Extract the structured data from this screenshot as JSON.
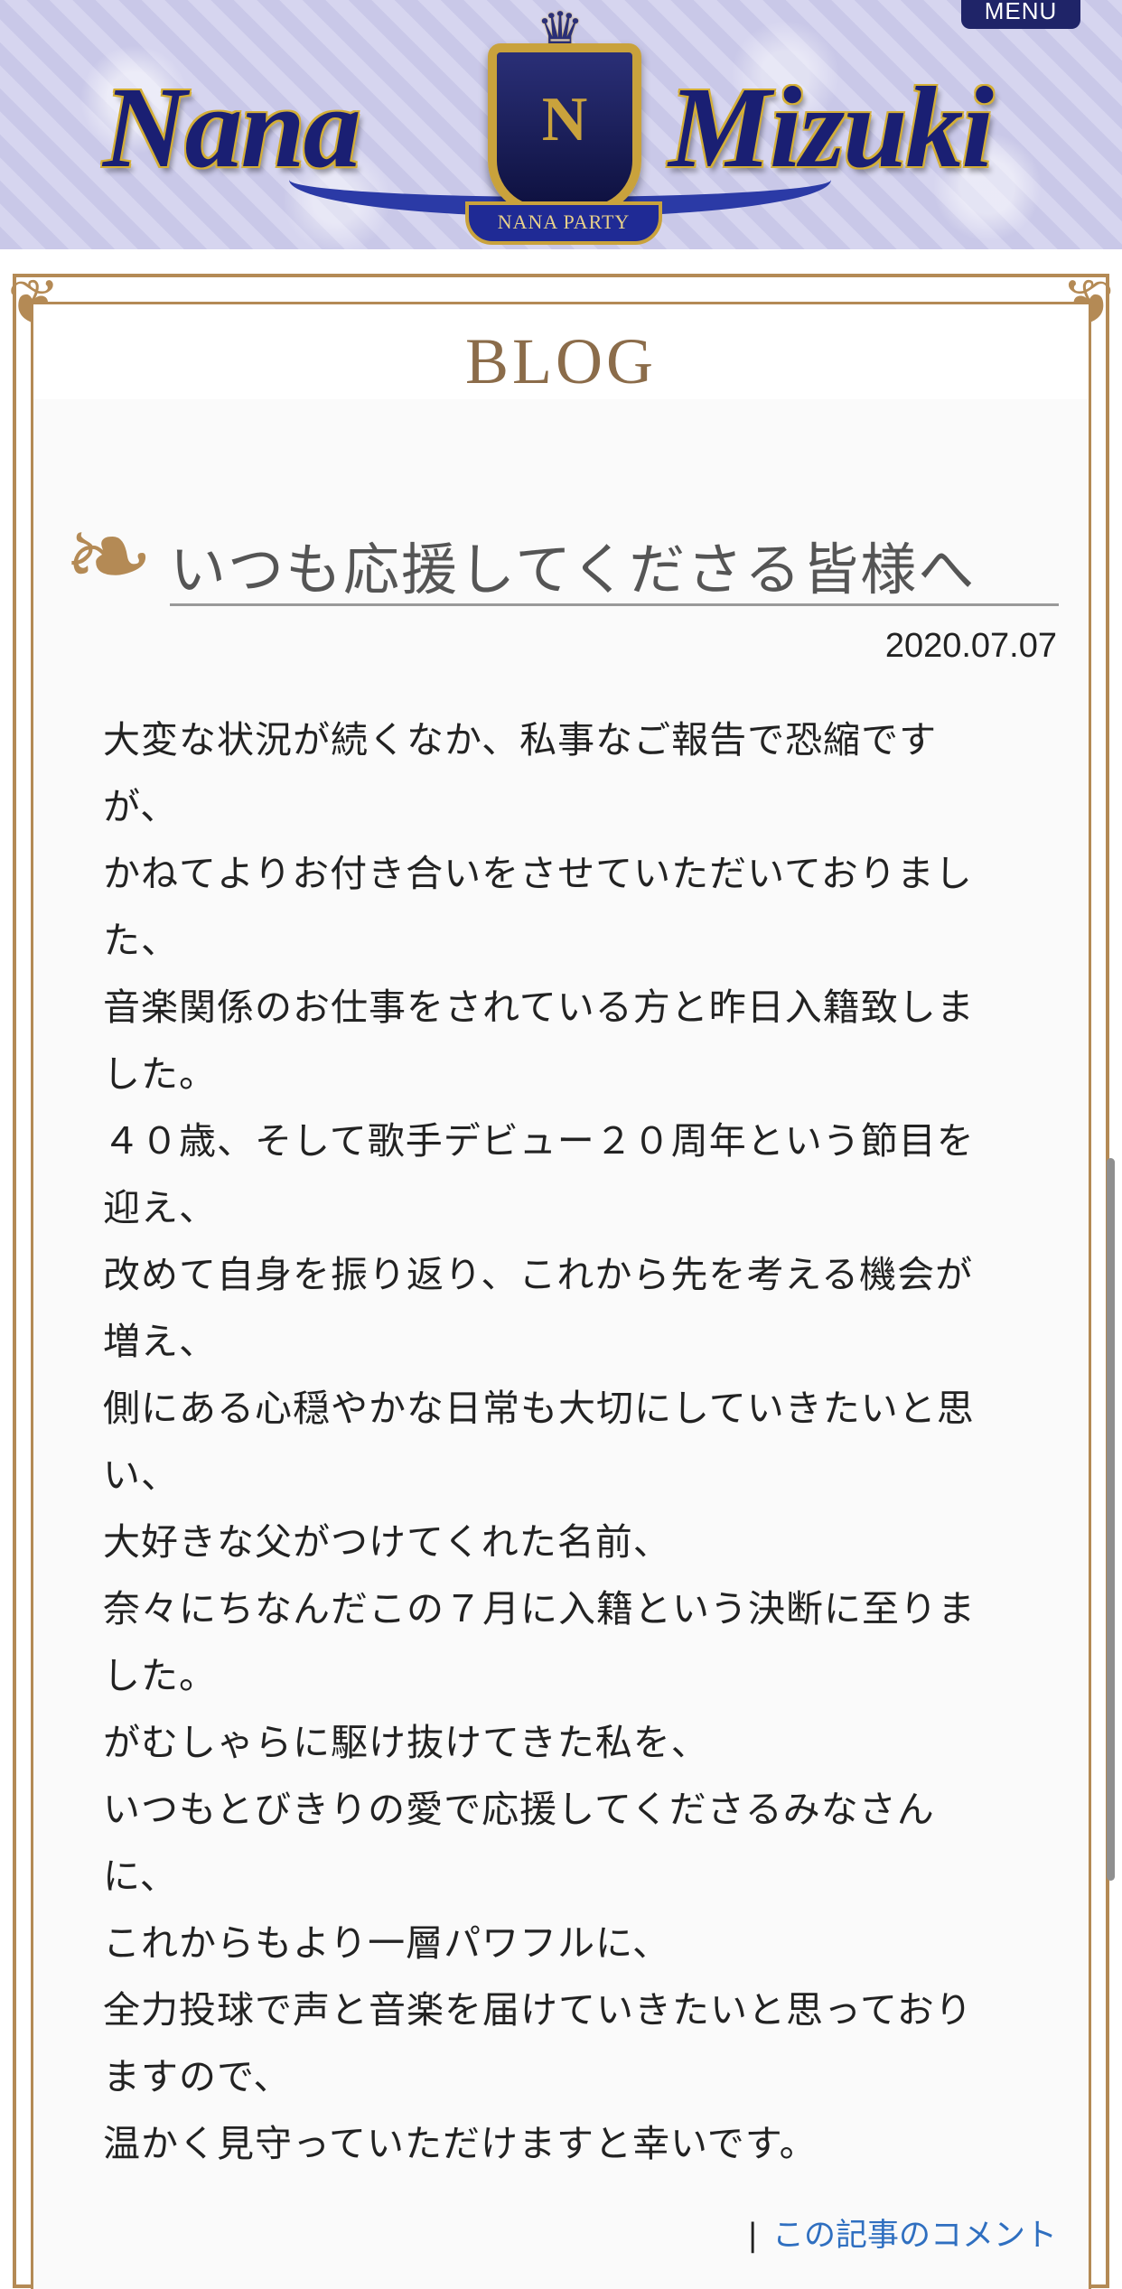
{
  "header": {
    "menu_label": "MENU",
    "logo_left": "Nana",
    "logo_right": "Mizuki",
    "crest_letter": "N",
    "tagline": "NANA PARTY"
  },
  "section": {
    "title": "BLOG"
  },
  "post": {
    "title": "いつも応援してくださる皆様へ",
    "date": "2020.07.07",
    "body_lines": [
      "大変な状況が続くなか、私事なご報告で恐縮です",
      "が、",
      "かねてよりお付き合いをさせていただいておりまし",
      "た、",
      "音楽関係のお仕事をされている方と昨日入籍致しま",
      "した。",
      "４０歳、そして歌手デビュー２０周年という節目を",
      "迎え、",
      "改めて自身を振り返り、これから先を考える機会が",
      "増え、",
      "側にある心穏やかな日常も大切にしていきたいと思",
      "い、",
      "大好きな父がつけてくれた名前、",
      "奈々にちなんだこの７月に入籍という決断に至りま",
      "した。",
      "がむしゃらに駆け抜けてきた私を、",
      "いつもとびきりの愛で応援してくださるみなさん",
      "に、",
      "これからもより一層パワフルに、",
      "全力投球で声と音楽を届けていきたいと思っており",
      "ますので、",
      "温かく見守っていただけますと幸いです。"
    ],
    "footer_separator": "|",
    "comment_link": "この記事のコメント"
  },
  "icons": {
    "ornament": "scroll-ornament-icon",
    "crown": "crown-icon"
  },
  "colors": {
    "frame": "#b48a55",
    "menu_bg": "#1f2468",
    "link": "#2f6fc0"
  }
}
